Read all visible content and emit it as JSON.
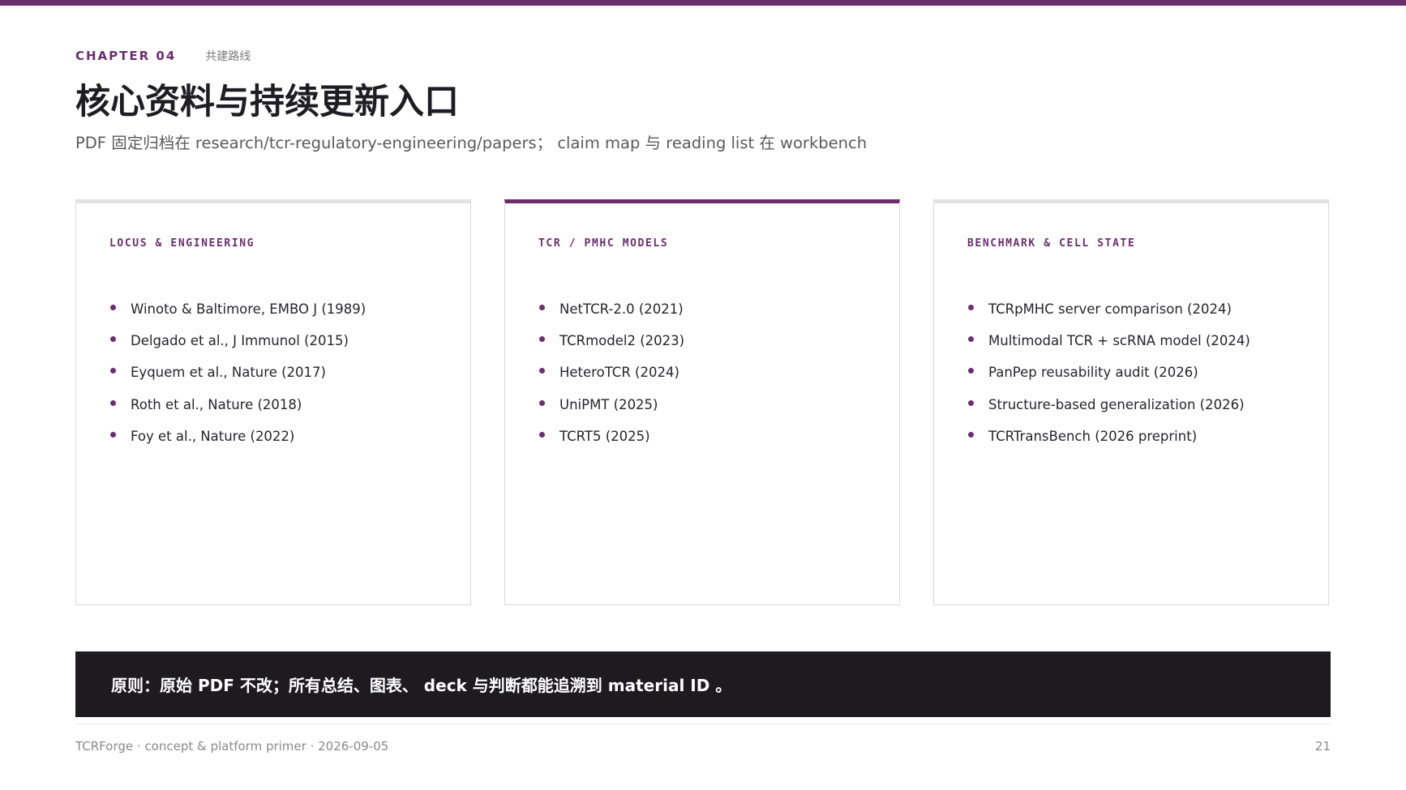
{
  "header": {
    "chapter_label": "CHAPTER 04",
    "chapter_subtitle": "共建路线",
    "title": "核心资料与持续更新入口",
    "subtitle": "PDF 固定归档在 research/tcr-regulatory-engineering/papers； claim map 与 reading list 在 workbench"
  },
  "cards": [
    {
      "heading": "LOCUS & ENGINEERING",
      "items": [
        "Winoto & Baltimore, EMBO J (1989)",
        "Delgado et al., J Immunol (2015)",
        "Eyquem et al., Nature (2017)",
        "Roth et al., Nature (2018)",
        "Foy et al., Nature (2022)"
      ]
    },
    {
      "heading": "TCR / PMHC MODELS",
      "items": [
        "NetTCR-2.0 (2021)",
        "TCRmodel2 (2023)",
        "HeteroTCR (2024)",
        "UniPMT (2025)",
        "TCRT5 (2025)"
      ]
    },
    {
      "heading": "BENCHMARK & CELL STATE",
      "items": [
        "TCRpMHC server comparison (2024)",
        "Multimodal TCR + scRNA model (2024)",
        "PanPep reusability audit (2026)",
        "Structure-based generalization (2026)",
        "TCRTransBench (2026 preprint)"
      ]
    }
  ],
  "principle": "原则：原始 PDF 不改；所有总结、图表、 deck 与判断都能追溯到 material ID 。",
  "footer": {
    "left": "TCRForge · concept & platform primer · 2026-09-05",
    "page_number": "21"
  },
  "colors": {
    "accent": "#6b2f6f",
    "dark_bar": "#1d1b20",
    "card_border": "#d9d9d9"
  }
}
